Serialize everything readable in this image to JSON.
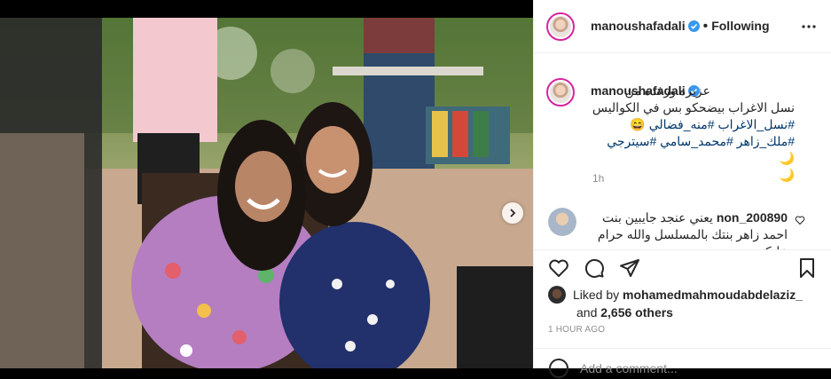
{
  "post": {
    "username": "manoushafadali",
    "following_label": "Following",
    "separator": "•",
    "caption_line1": "عزيزه ورغده من",
    "caption_line2": "نسل الاغراب بيضحكو بس في الكواليس",
    "caption_hashtags1": "#نسل_الاغراب #منه_فضالي",
    "caption_hashtags2": "#ملك_زاهر #محمد_سامي #سيترجي",
    "emoji_grin": "😄",
    "emoji_moon": "🌙",
    "time_ago_short": "1h",
    "comment_user": "non_200890",
    "comment_text": "يعني عنجد جايبين بنت احمد زاهر بنتك بالمسلسل والله حرام عليكم",
    "liked_by_prefix": "Liked by",
    "liked_by_user": "mohamedmahmoudabdelaziz_",
    "and_word": "and",
    "others_count": "2,656 others",
    "posted_ago": "1 HOUR AGO",
    "add_comment_placeholder": "Add a comment..."
  },
  "colors": {
    "link": "#00376b",
    "muted": "#8e8e8e",
    "verified": "#3897f0",
    "story_ring": "#d6249f"
  },
  "icons": [
    "verified-badge-icon",
    "more-options-icon",
    "chevron-right-icon",
    "heart-icon",
    "comment-icon",
    "share-icon",
    "bookmark-icon",
    "small-heart-icon",
    "emoji-icon"
  ]
}
